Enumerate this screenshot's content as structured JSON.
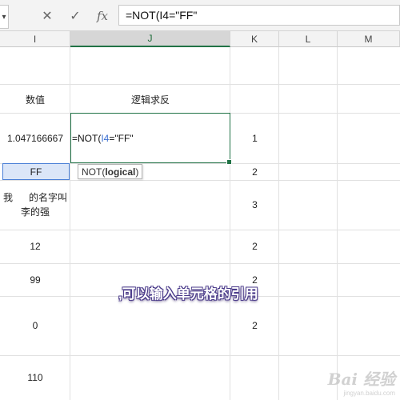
{
  "formula_bar": {
    "name_box_tail": "▾",
    "cancel_icon": "✕",
    "enter_icon": "✓",
    "fx_label": "fx",
    "formula": "=NOT(I4=\"FF\""
  },
  "columns": [
    "I",
    "J",
    "K",
    "L",
    "M"
  ],
  "cells": {
    "i_header": "数值",
    "j_header": "逻辑求反",
    "i4": "1.047166667",
    "k4": "1",
    "i5": "FF",
    "k5": "2",
    "i6": "我      的名字叫\n李的强",
    "k6": "3",
    "i7": "12",
    "k7": "2",
    "i8": "99",
    "k8": "2",
    "i9": "0",
    "k9": "2",
    "i10": "110"
  },
  "editing": {
    "prefix": "=NOT(",
    "ref": "I4",
    "suffix": "=\"FF\""
  },
  "tooltip": {
    "func": "NOT(",
    "arg": "logical",
    "close": ")"
  },
  "caption": ",可以输入单元格的引用",
  "watermark": {
    "logo": "Bai 经验",
    "url": "jingyan.baidu.com"
  },
  "colors": {
    "excel_green": "#217346",
    "reference_blue": "#3b6fd1"
  }
}
